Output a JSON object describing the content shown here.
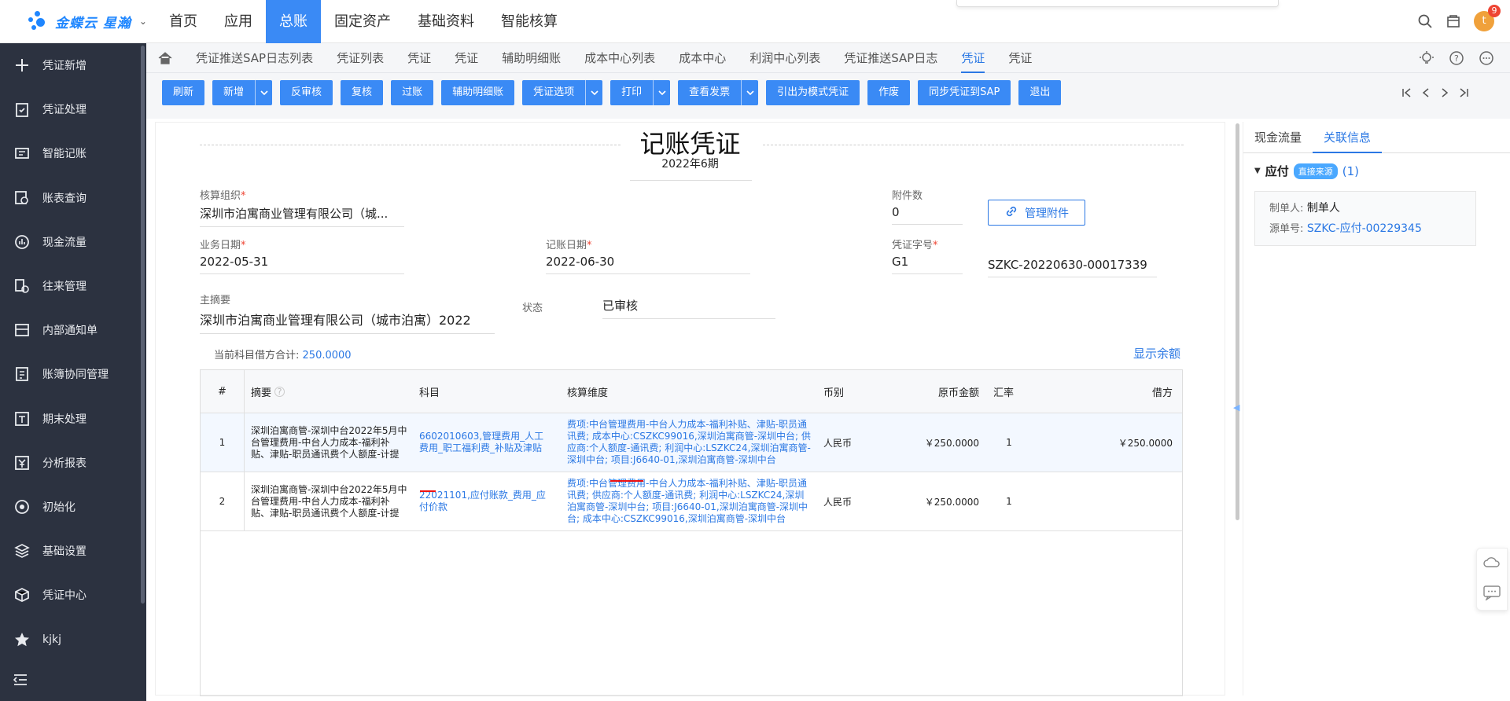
{
  "app": {
    "brand": "金蝶云 星瀚",
    "notif_count": "9",
    "avatar_initial": "t"
  },
  "topnav": [
    "首页",
    "应用",
    "总账",
    "固定资产",
    "基础资料",
    "智能核算"
  ],
  "sidebar": [
    "凭证新增",
    "凭证处理",
    "智能记账",
    "账表查询",
    "现金流量",
    "往来管理",
    "内部通知单",
    "账簿协同管理",
    "期末处理",
    "分析报表",
    "初始化",
    "基础设置",
    "凭证中心",
    "kjkj"
  ],
  "tabs": [
    "凭证推送SAP日志列表",
    "凭证列表",
    "凭证",
    "凭证",
    "辅助明细账",
    "成本中心列表",
    "成本中心",
    "利润中心列表",
    "凭证推送SAP日志",
    "凭证",
    "凭证"
  ],
  "toolbar": [
    {
      "label": "刷新",
      "dd": false
    },
    {
      "label": "新增",
      "dd": true
    },
    {
      "label": "反审核",
      "dd": false
    },
    {
      "label": "复核",
      "dd": false
    },
    {
      "label": "过账",
      "dd": false
    },
    {
      "label": "辅助明细账",
      "dd": false
    },
    {
      "label": "凭证选项",
      "dd": true
    },
    {
      "label": "打印",
      "dd": true
    },
    {
      "label": "查看发票",
      "dd": true
    },
    {
      "label": "引出为模式凭证",
      "dd": false
    },
    {
      "label": "作废",
      "dd": false
    },
    {
      "label": "同步凭证到SAP",
      "dd": false
    },
    {
      "label": "退出",
      "dd": false
    }
  ],
  "voucher": {
    "title": "记账凭证",
    "period": "2022年6期",
    "org_label": "核算组织",
    "org_value": "深圳市泊寓商业管理有限公司（城...",
    "attach_label": "附件数",
    "attach_value": "0",
    "attach_btn": "管理附件",
    "bizdate_label": "业务日期",
    "bizdate_value": "2022-05-31",
    "bookdate_label": "记账日期",
    "bookdate_value": "2022-06-30",
    "word_label": "凭证字号",
    "word_value": "G1",
    "billno": "SZKC-20220630-00017339",
    "summary_label": "主摘要",
    "summary_value": "深圳市泊寓商业管理有限公司（城市泊寓）2022",
    "status_label": "状态",
    "status_value": "已审核",
    "sum_label": "当前科目借方合计:",
    "sum_value": "250.0000",
    "show_balance": "显示余额"
  },
  "grid": {
    "headers": [
      "#",
      "摘要",
      "科目",
      "核算维度",
      "币别",
      "原币金额",
      "汇率",
      "借方"
    ],
    "rows": [
      {
        "no": "1",
        "summary": "深圳泊寓商管-深圳中台2022年5月中台管理费用-中台人力成本-福利补贴、津贴-职员通讯费个人额度-计提",
        "account": "6602010603,管理费用_人工费用_职工福利费_补贴及津贴",
        "dims": "费项:中台管理费用-中台人力成本-福利补贴、津贴-职员通讯费; 成本中心:CSZKC99016,深圳泊寓商管-深圳中台; 供应商:个人额度-通讯费; 利润中心:LSZKC24,深圳泊寓商管-深圳中台; 项目:J6640-01,深圳泊寓商管-深圳中台",
        "currency": "人民币",
        "orig_amount": "￥250.0000",
        "rate": "1",
        "debit": "￥250.0000"
      },
      {
        "no": "2",
        "summary": "深圳泊寓商管-深圳中台2022年5月中台管理费用-中台人力成本-福利补贴、津贴-职员通讯费个人额度-计提",
        "account": "22021101,应付账款_费用_应付价款",
        "dims": "费项:中台管理费用-中台人力成本-福利补贴、津贴-职员通讯费; 供应商:个人额度-通讯费; 利润中心:LSZKC24,深圳泊寓商管-深圳中台; 项目:J6640-01,深圳泊寓商管-深圳中台; 成本中心:CSZKC99016,深圳泊寓商管-深圳中台",
        "currency": "人民币",
        "orig_amount": "￥250.0000",
        "rate": "1",
        "debit": ""
      }
    ]
  },
  "right": {
    "tabs": [
      "现金流量",
      "关联信息"
    ],
    "section": "应付",
    "badge": "直接来源",
    "count": "(1)",
    "maker_label": "制单人:",
    "maker_value": "制单人",
    "src_label": "源单号:",
    "src_value": "SZKC-应付-00229345"
  }
}
